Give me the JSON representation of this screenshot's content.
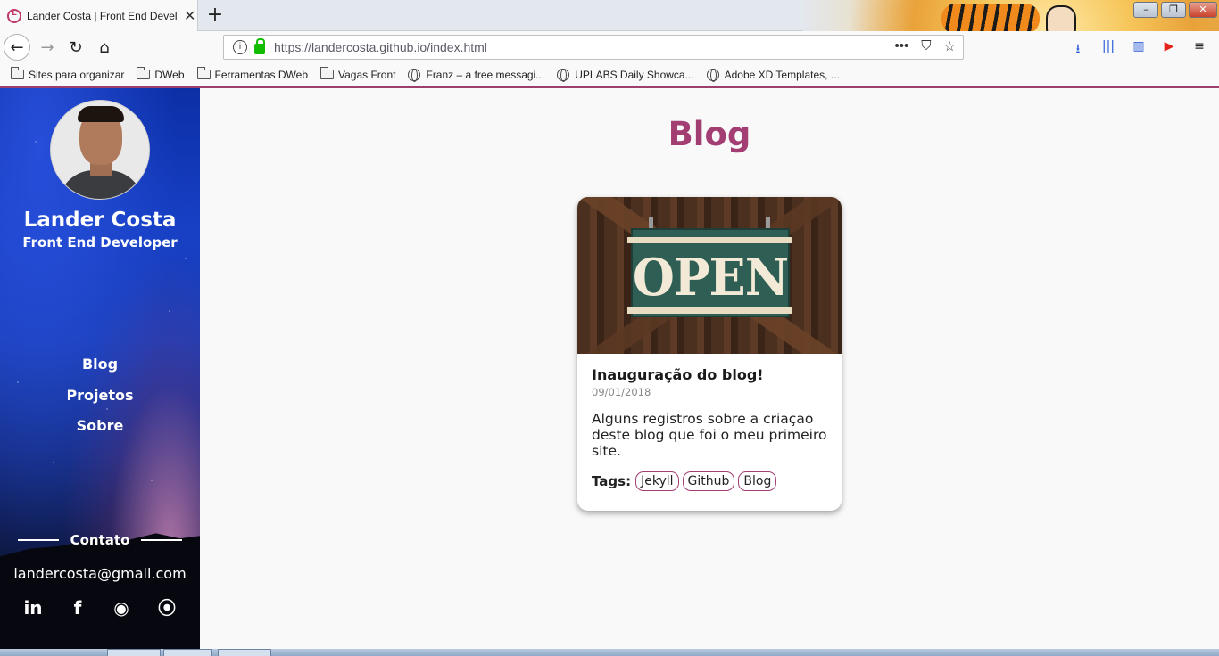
{
  "browser": {
    "tab_title": "Lander Costa | Front End Developer",
    "tab_close_glyph": "✕",
    "newtab_glyph": "+",
    "url": "https://landercosta.github.io/index.html",
    "url_info_glyph": "i",
    "url_more_glyph": "•••",
    "url_pocket_glyph": "⛉",
    "url_star_glyph": "☆",
    "back_glyph": "←",
    "forward_glyph": "→",
    "reload_glyph": "↻",
    "home_glyph": "⌂",
    "toolbar_icons": [
      "download-icon",
      "library-icon",
      "sidebar-icon",
      "youtube-icon",
      "menu-icon"
    ],
    "toolbar_glyphs": [
      "⭳",
      "|||",
      "▥",
      "▶",
      "≡"
    ],
    "window_controls": {
      "minimize": "–",
      "maximize": "❐",
      "close": "✕"
    },
    "bookmarks": [
      {
        "label": "Sites para organizar",
        "type": "folder"
      },
      {
        "label": "DWeb",
        "type": "folder"
      },
      {
        "label": "Ferramentas DWeb",
        "type": "folder"
      },
      {
        "label": "Vagas Front",
        "type": "folder"
      },
      {
        "label": "Franz – a free messagi...",
        "type": "link"
      },
      {
        "label": "UPLABS Daily Showca...",
        "type": "link"
      },
      {
        "label": "Adobe XD Templates, ...",
        "type": "link"
      }
    ]
  },
  "sidebar": {
    "name": "Lander Costa",
    "role": "Front End Developer",
    "nav": [
      {
        "label": "Blog"
      },
      {
        "label": "Projetos"
      },
      {
        "label": "Sobre"
      }
    ],
    "contact_title": "Contato",
    "email": "landercosta@gmail.com",
    "social": [
      {
        "icon": "linkedin-icon",
        "glyph": "in"
      },
      {
        "icon": "facebook-icon",
        "glyph": "f"
      },
      {
        "icon": "github-icon",
        "glyph": "◉"
      },
      {
        "icon": "rss-icon",
        "glyph": "⦿"
      }
    ]
  },
  "main": {
    "title": "Blog",
    "posts": [
      {
        "image_text": "OPEN",
        "title": "Inauguração do blog!",
        "date": "09/01/2018",
        "excerpt": "Alguns registros sobre a criaçao deste blog que foi o meu primeiro site.",
        "tags_label": "Tags:",
        "tags": [
          "Jekyll",
          "Github",
          "Blog"
        ]
      }
    ]
  },
  "colors": {
    "accent": "#a23e72",
    "sidebar_top": "#0c2fa6",
    "sidebar_bottom": "#0a0c1c"
  }
}
